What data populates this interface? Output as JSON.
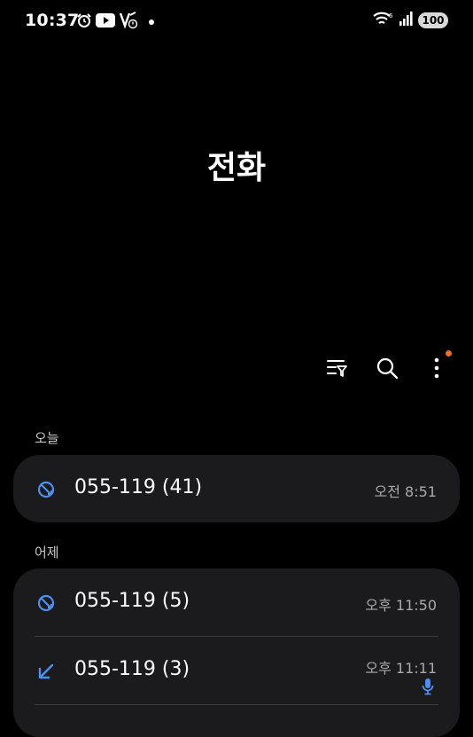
{
  "status_bar": {
    "time": "10:37",
    "left_icons": [
      "alarm-icon",
      "youtube-icon",
      "volte-icon"
    ],
    "right_icons": [
      "wifi-icon",
      "signal-icon"
    ],
    "battery": "100"
  },
  "header": {
    "title": "전화"
  },
  "toolbar": {
    "items": [
      "filter-icon",
      "search-icon",
      "more-options-icon"
    ],
    "notification_dot_color": "#f06d28"
  },
  "sections": [
    {
      "label": "오늘",
      "calls": [
        {
          "number": "055-119 (41)",
          "time": "오전 8:51",
          "type": "blocked",
          "icon": "blocked-call-icon",
          "recording": false
        }
      ]
    },
    {
      "label": "어제",
      "calls": [
        {
          "number": "055-119 (5)",
          "time": "오후 11:50",
          "type": "blocked",
          "icon": "blocked-call-icon",
          "recording": false
        },
        {
          "number": "055-119 (3)",
          "time": "오후 11:11",
          "type": "incoming",
          "icon": "incoming-call-icon",
          "recording": true
        }
      ]
    }
  ],
  "colors": {
    "accent": "#4a90f0",
    "card_bg": "#1b1b1d",
    "muted_text": "#a9a9ab"
  }
}
